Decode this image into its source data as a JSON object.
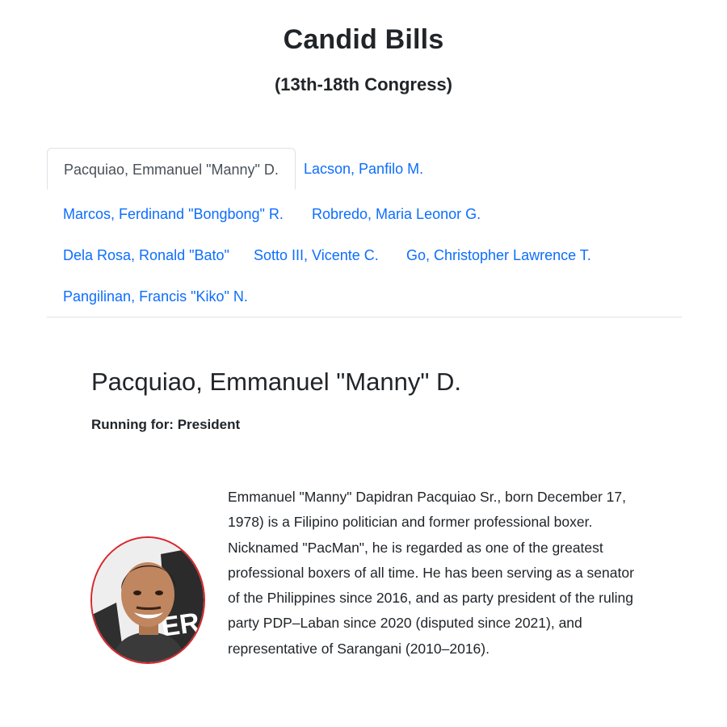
{
  "header": {
    "title": "Candid Bills",
    "subtitle": "(13th-18th Congress)"
  },
  "tabs": [
    {
      "label": "Pacquiao, Emmanuel \"Manny\" D.",
      "active": true
    },
    {
      "label": "Lacson, Panfilo M.",
      "active": false
    },
    {
      "label": "Marcos, Ferdinand \"Bongbong\" R.",
      "active": false
    },
    {
      "label": "Robredo, Maria Leonor G.",
      "active": false
    },
    {
      "label": "Dela Rosa, Ronald \"Bato\"",
      "active": false
    },
    {
      "label": "Sotto III, Vicente C.",
      "active": false
    },
    {
      "label": "Go, Christopher Lawrence T.",
      "active": false
    },
    {
      "label": "Pangilinan, Francis \"Kiko\" N.",
      "active": false
    }
  ],
  "profile": {
    "name": "Pacquiao, Emmanuel \"Manny\" D.",
    "running_for": "Running for: President",
    "bio": "Emmanuel \"Manny\" Dapidran Pacquiao Sr., born December 17, 1978) is a Filipino politician and former professional boxer. Nicknamed \"PacMan\", he is regarded as one of the greatest professional boxers of all time. He has been serving as a senator of the Philippines since 2016, and as party president of the ruling party PDP–Laban since 2020 (disputed since 2021), and representative of Sarangani (2010–2016).",
    "photo_backdrop_text": "ERA"
  },
  "colors": {
    "link": "#0d6efd",
    "text": "#212529",
    "active_tab_text": "#495057",
    "border": "#dee2e6",
    "avatar_border": "#d9262b"
  }
}
